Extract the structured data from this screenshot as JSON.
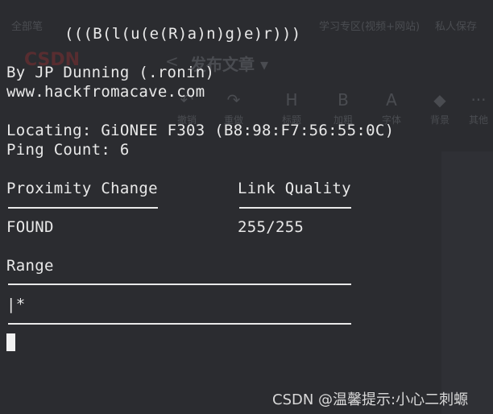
{
  "background_app": {
    "bookmarks": [
      "全部笔",
      "学习专区(视频+网站)",
      "私人保存"
    ],
    "logo": "CSDN",
    "back_symbol": "<",
    "page_title": "发布文章 ▾",
    "tools": [
      {
        "glyph": "↶",
        "label": "撤销"
      },
      {
        "glyph": "↷",
        "label": "重做"
      },
      {
        "glyph": "H",
        "label": "标题"
      },
      {
        "glyph": "B",
        "label": "加粗"
      },
      {
        "glyph": "A",
        "label": "字体"
      },
      {
        "glyph": "◆",
        "label": "背景"
      },
      {
        "glyph": "···",
        "label": "其他"
      }
    ]
  },
  "terminal": {
    "banner": "(((B(l(u(e(R)a)n)g)e)r)))",
    "author": "By JP Dunning (.ronin)",
    "website": "www.hackfromacave.com",
    "locating_label": "Locating:",
    "device_name": "GiONEE F303",
    "device_mac": "(B8:98:F7:56:55:0C)",
    "ping_label": "Ping Count:",
    "ping_count": "6",
    "proximity_header": "Proximity Change",
    "link_quality_header": "Link Quality",
    "proximity_value": "FOUND",
    "link_quality_value": "255/255",
    "range_header": "Range",
    "range_bar": "|*"
  },
  "watermark": "CSDN @温馨提示:小心二刺螈"
}
